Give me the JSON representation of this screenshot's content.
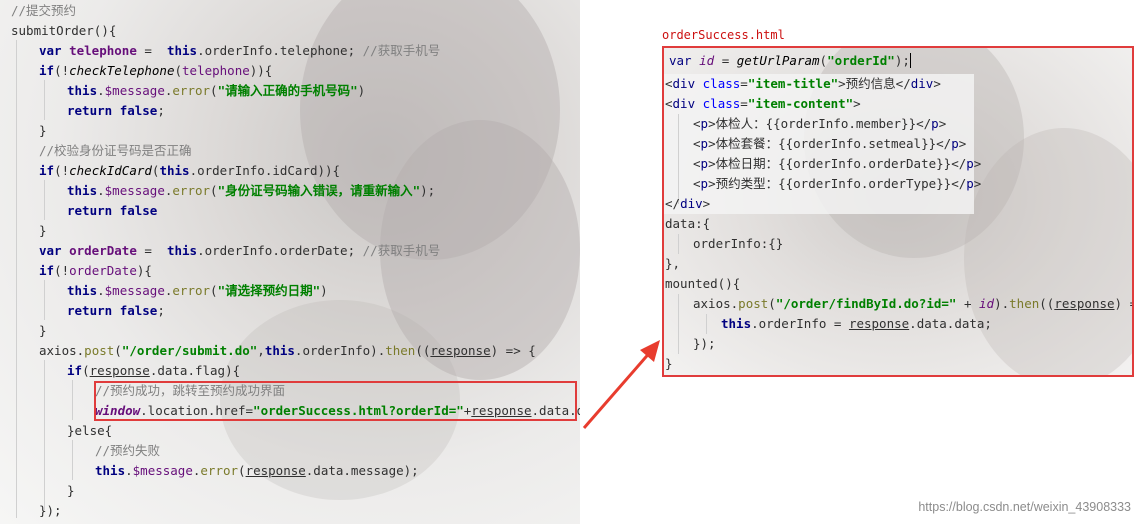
{
  "left_code": {
    "comment_submit": "//提交预约",
    "fn_name": "submitOrder",
    "fn_open": "(){",
    "kw_var": "var",
    "kw_this": "this",
    "kw_if": "if",
    "kw_return": "return",
    "kw_false": "false",
    "line_telephone_var": "telephone",
    "line_telephone_rest": ".orderInfo.telephone; ",
    "comment_get_phone": "//获取手机号",
    "check_phone_fn": "checkTelephone",
    "check_phone_arg": "telephone",
    "message_prop": "$message",
    "error_fn": "error",
    "msg_phone_error": "\"请输入正确的手机号码\"",
    "comment_check_id": "//校验身份证号码是否正确",
    "check_id_fn": "checkIdCard",
    "check_id_arg": ".orderInfo.idCard",
    "msg_id_error": "\"身份证号码输入错误，请重新输入\"",
    "order_date_var": "orderDate",
    "order_date_rest": ".orderInfo.orderDate; ",
    "msg_date_error": "\"请选择预约日期\"",
    "axios": "axios",
    "post_fn": "post",
    "post_url": "\"/order/submit.do\"",
    "post_rest": ".orderInfo).",
    "then_fn": "then",
    "response": "response",
    "data_flag": ".data.flag",
    "comment_success": "//预约成功，跳转至预约成功界面",
    "window_obj": "window",
    "location_href": ".location.href=",
    "href_string": "\"orderSuccess.html?orderId=\"",
    "data_data": ".data.data;",
    "else_kw": "}else{",
    "comment_fail": "//预约失败",
    "data_message": ".data.message);",
    "closing": "});"
  },
  "right_code": {
    "file_title": "orderSuccess.html",
    "var_kw": "var",
    "id_var": "id",
    "get_param_fn": "getUrlParam",
    "order_id_str": "\"orderId\"",
    "tag_div": "div",
    "tag_p": "p",
    "attr_class": "class",
    "item_title_val": "\"item-title\"",
    "title_text": "预约信息",
    "item_content_val": "\"item-content\"",
    "p_member": "体检人：{{orderInfo.member}}",
    "p_setmeal": "体检套餐：{{orderInfo.setmeal}}",
    "p_order_date": "体检日期：{{orderInfo.orderDate}}",
    "p_order_type": "预约类型：{{orderInfo.orderType}}",
    "data_label": "data:{",
    "order_info_label": "orderInfo:{}",
    "data_close": "},",
    "mounted": "mounted(){",
    "axios": "axios",
    "post_fn": "post",
    "find_url": "\"/order/findById.do?id=\"",
    "then_fn": "then",
    "response": "response",
    "this_kw": "this",
    "order_info_assign": ".orderInfo = ",
    "data_data": ".data.data;",
    "inner_close": "});",
    "outer_close": "}"
  },
  "watermark": "https://blog.csdn.net/weixin_43908333",
  "colors": {
    "highlight_border": "#e03c3c",
    "keyword": "#000080",
    "string": "#008000",
    "comment": "#808080"
  },
  "icons": {
    "connector": "red-arrow-icon"
  }
}
